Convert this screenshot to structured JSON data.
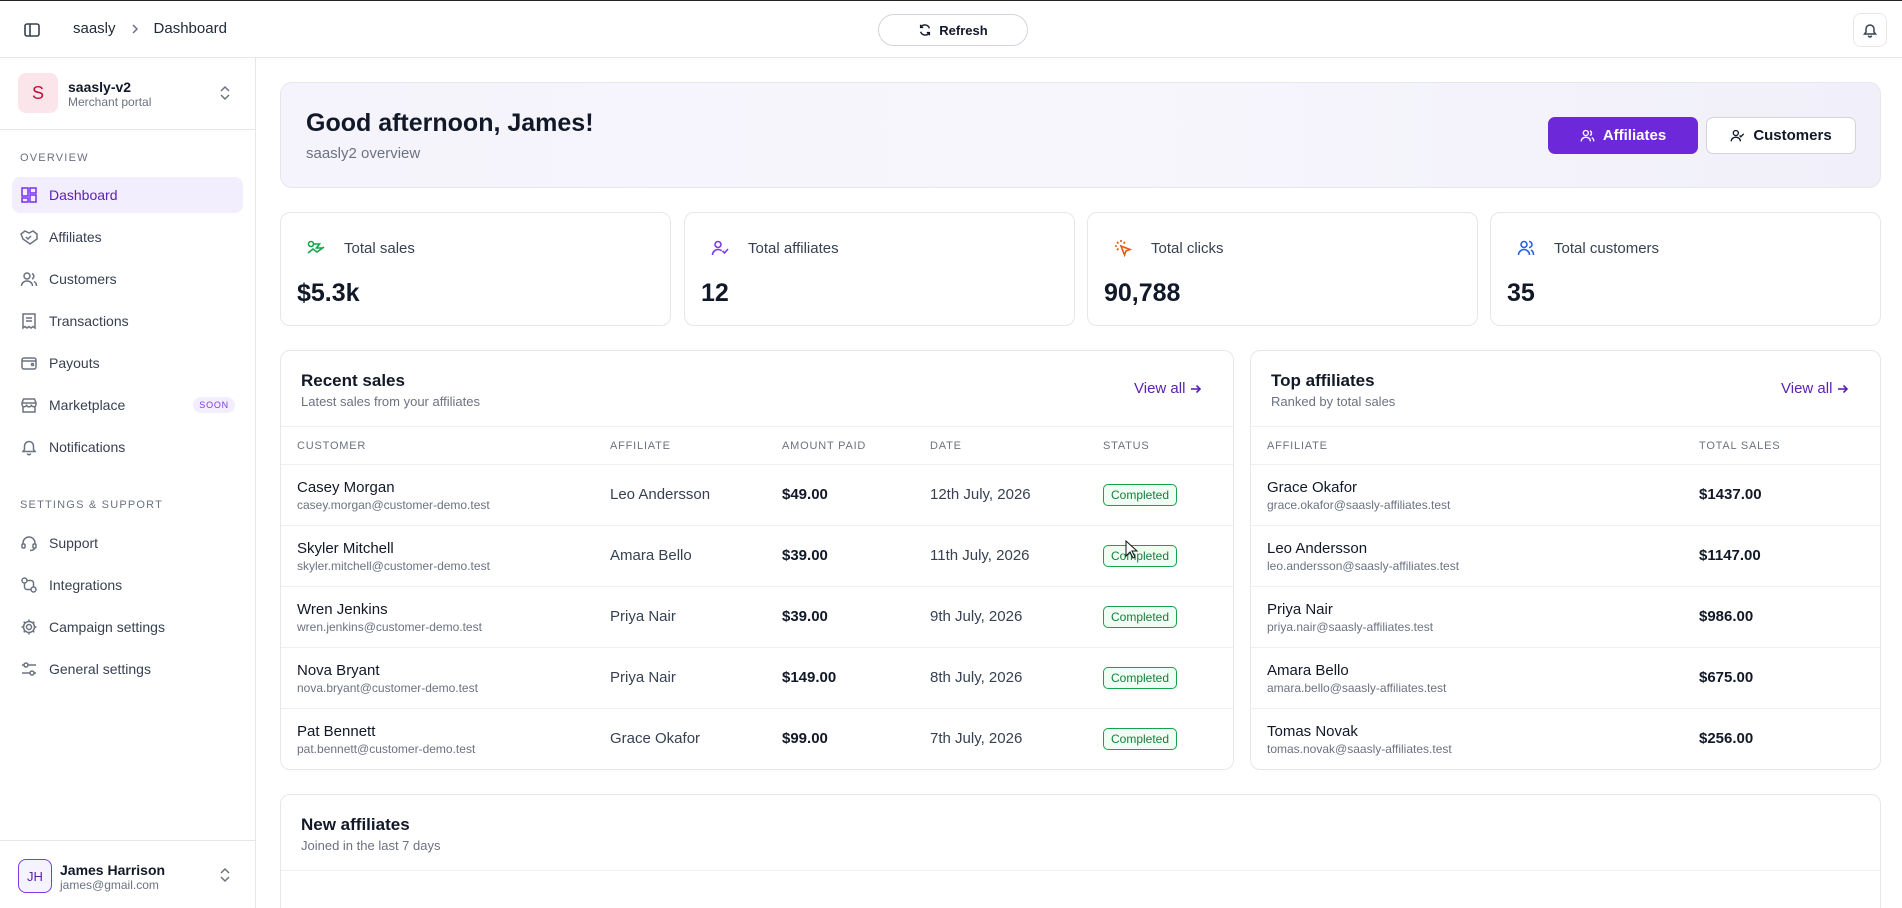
{
  "topbar": {
    "breadcrumb": [
      "saasly",
      "Dashboard"
    ],
    "refresh_label": "Refresh"
  },
  "sidebar": {
    "workspace": {
      "initial": "S",
      "name": "saasly-v2",
      "subtitle": "Merchant portal"
    },
    "overview_label": "OVERVIEW",
    "settings_label": "SETTINGS & SUPPORT",
    "overview_items": [
      {
        "label": "Dashboard",
        "icon": "dashboard-icon",
        "active": true
      },
      {
        "label": "Affiliates",
        "icon": "handshake-icon"
      },
      {
        "label": "Customers",
        "icon": "users-icon"
      },
      {
        "label": "Transactions",
        "icon": "receipt-icon"
      },
      {
        "label": "Payouts",
        "icon": "wallet-icon"
      },
      {
        "label": "Marketplace",
        "icon": "store-icon",
        "badge": "SOON"
      },
      {
        "label": "Notifications",
        "icon": "bell-icon"
      }
    ],
    "settings_items": [
      {
        "label": "Support",
        "icon": "headset-icon"
      },
      {
        "label": "Integrations",
        "icon": "integrations-icon"
      },
      {
        "label": "Campaign settings",
        "icon": "gear-icon"
      },
      {
        "label": "General settings",
        "icon": "sliders-icon"
      }
    ],
    "user": {
      "initials": "JH",
      "name": "James Harrison",
      "email": "james@gmail.com"
    }
  },
  "hero": {
    "title": "Good afternoon, James!",
    "subtitle": "saasly2 overview",
    "affiliates_button": "Affiliates",
    "customers_button": "Customers"
  },
  "stats": [
    {
      "label": "Total sales",
      "value": "$5.3k",
      "icon": "trending-icon",
      "color": "#16a34a"
    },
    {
      "label": "Total affiliates",
      "value": "12",
      "icon": "user-check-icon",
      "color": "#7c3aed"
    },
    {
      "label": "Total clicks",
      "value": "90,788",
      "icon": "cursor-click-icon",
      "color": "#ea580c"
    },
    {
      "label": "Total customers",
      "value": "35",
      "icon": "users-icon",
      "color": "#2563eb"
    }
  ],
  "recent_sales": {
    "title": "Recent sales",
    "subtitle": "Latest sales from your affiliates",
    "view_all": "View all",
    "columns": [
      "CUSTOMER",
      "AFFILIATE",
      "AMOUNT PAID",
      "DATE",
      "STATUS"
    ],
    "rows": [
      {
        "name": "Casey Morgan",
        "email": "casey.morgan@customer-demo.test",
        "affiliate": "Leo Andersson",
        "amount": "$49.00",
        "date": "12th July, 2026",
        "status": "Completed"
      },
      {
        "name": "Skyler Mitchell",
        "email": "skyler.mitchell@customer-demo.test",
        "affiliate": "Amara Bello",
        "amount": "$39.00",
        "date": "11th July, 2026",
        "status": "Completed"
      },
      {
        "name": "Wren Jenkins",
        "email": "wren.jenkins@customer-demo.test",
        "affiliate": "Priya Nair",
        "amount": "$39.00",
        "date": "9th July, 2026",
        "status": "Completed"
      },
      {
        "name": "Nova Bryant",
        "email": "nova.bryant@customer-demo.test",
        "affiliate": "Priya Nair",
        "amount": "$149.00",
        "date": "8th July, 2026",
        "status": "Completed"
      },
      {
        "name": "Pat Bennett",
        "email": "pat.bennett@customer-demo.test",
        "affiliate": "Grace Okafor",
        "amount": "$99.00",
        "date": "7th July, 2026",
        "status": "Completed"
      }
    ]
  },
  "top_affiliates": {
    "title": "Top affiliates",
    "subtitle": "Ranked by total sales",
    "view_all": "View all",
    "columns": [
      "AFFILIATE",
      "TOTAL SALES"
    ],
    "rows": [
      {
        "name": "Grace Okafor",
        "email": "grace.okafor@saasly-affiliates.test",
        "total": "$1437.00"
      },
      {
        "name": "Leo Andersson",
        "email": "leo.andersson@saasly-affiliates.test",
        "total": "$1147.00"
      },
      {
        "name": "Priya Nair",
        "email": "priya.nair@saasly-affiliates.test",
        "total": "$986.00"
      },
      {
        "name": "Amara Bello",
        "email": "amara.bello@saasly-affiliates.test",
        "total": "$675.00"
      },
      {
        "name": "Tomas Novak",
        "email": "tomas.novak@saasly-affiliates.test",
        "total": "$256.00"
      }
    ]
  },
  "new_affiliates": {
    "title": "New affiliates",
    "subtitle": "Joined in the last 7 days"
  },
  "colors": {
    "accent": "#6d28d9",
    "success": "#16a34a"
  }
}
